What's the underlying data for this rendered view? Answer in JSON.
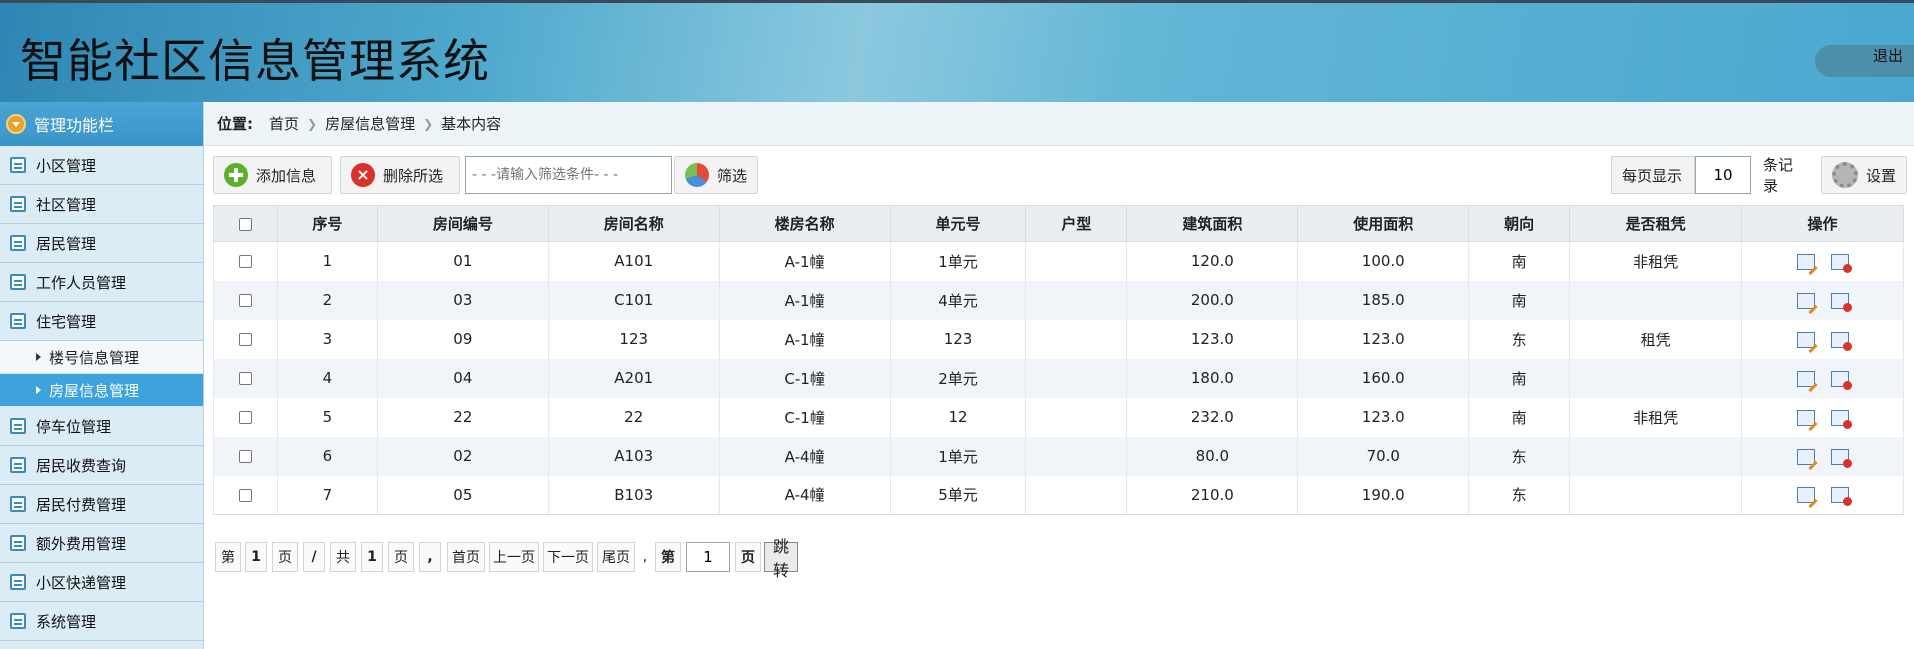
{
  "app": {
    "title": "智能社区信息管理系统",
    "logout": "退出"
  },
  "sidebar": {
    "header": "管理功能栏",
    "items": [
      {
        "label": "小区管理"
      },
      {
        "label": "社区管理"
      },
      {
        "label": "居民管理"
      },
      {
        "label": "工作人员管理"
      },
      {
        "label": "住宅管理"
      }
    ],
    "subitems": [
      {
        "label": "楼号信息管理",
        "active": false
      },
      {
        "label": "房屋信息管理",
        "active": true
      }
    ],
    "items2": [
      {
        "label": "停车位管理"
      },
      {
        "label": "居民收费查询"
      },
      {
        "label": "居民付费管理"
      },
      {
        "label": "额外费用管理"
      },
      {
        "label": "小区快递管理"
      },
      {
        "label": "系统管理"
      }
    ]
  },
  "breadcrumb": {
    "label": "位置:",
    "items": [
      "首页",
      "房屋信息管理",
      "基本内容"
    ]
  },
  "toolbar": {
    "add_label": "添加信息",
    "delete_label": "删除所选",
    "filter_placeholder": "- - -请输入筛选条件- - -",
    "filter_label": "筛选",
    "perpage_label": "每页显示",
    "perpage_value": "10",
    "perpage_unit": "条记录",
    "settings_label": "设置"
  },
  "table": {
    "columns": [
      "序号",
      "房间编号",
      "房间名称",
      "楼房名称",
      "单元号",
      "户型",
      "建筑面积",
      "使用面积",
      "朝向",
      "是否租凭",
      "操作"
    ],
    "rows": [
      [
        "1",
        "01",
        "A101",
        "A-1幢",
        "1单元",
        "",
        "120.0",
        "100.0",
        "南",
        "非租凭"
      ],
      [
        "2",
        "03",
        "C101",
        "A-1幢",
        "4单元",
        "",
        "200.0",
        "185.0",
        "南",
        ""
      ],
      [
        "3",
        "09",
        "123",
        "A-1幢",
        "123",
        "",
        "123.0",
        "123.0",
        "东",
        "租凭"
      ],
      [
        "4",
        "04",
        "A201",
        "C-1幢",
        "2单元",
        "",
        "180.0",
        "160.0",
        "南",
        ""
      ],
      [
        "5",
        "22",
        "22",
        "C-1幢",
        "12",
        "",
        "232.0",
        "123.0",
        "南",
        "非租凭"
      ],
      [
        "6",
        "02",
        "A103",
        "A-4幢",
        "1单元",
        "",
        "80.0",
        "70.0",
        "东",
        ""
      ],
      [
        "7",
        "05",
        "B103",
        "A-4幢",
        "5单元",
        "",
        "210.0",
        "190.0",
        "东",
        ""
      ]
    ]
  },
  "pager": {
    "di": "第",
    "page": "1",
    "ye": "页",
    "slash": "/",
    "gong": "共",
    "total": "1",
    "ye2": "页",
    "comma": ",",
    "first": "首页",
    "prev": "上一页",
    "next": "下一页",
    "last": "尾页",
    "comma2": ",",
    "di2": "第",
    "jump_value": "1",
    "ye3": "页",
    "go": "跳转"
  }
}
